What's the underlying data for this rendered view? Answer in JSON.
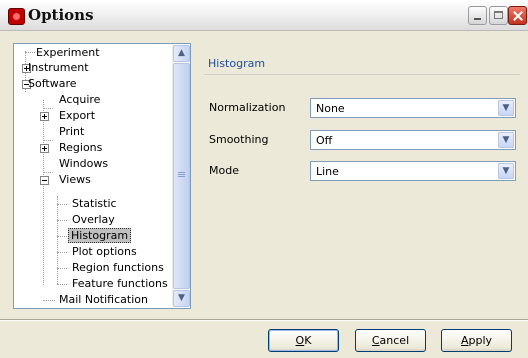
{
  "window": {
    "title": "Options"
  },
  "tree": {
    "items": [
      {
        "label": "Experiment"
      },
      {
        "label": "Instrument"
      },
      {
        "label": "Software"
      },
      {
        "label": "Acquire"
      },
      {
        "label": "Export"
      },
      {
        "label": "Print"
      },
      {
        "label": "Regions"
      },
      {
        "label": "Windows"
      },
      {
        "label": "Views"
      },
      {
        "label": "Statistic"
      },
      {
        "label": "Overlay"
      },
      {
        "label": "Histogram"
      },
      {
        "label": "Plot options"
      },
      {
        "label": "Region functions"
      },
      {
        "label": "Feature functions"
      },
      {
        "label": "Mail Notification"
      }
    ],
    "selected": "Histogram"
  },
  "panel": {
    "title": "Histogram",
    "fields": [
      {
        "label": "Normalization",
        "value": "None"
      },
      {
        "label": "Smoothing",
        "value": "Off"
      },
      {
        "label": "Mode",
        "value": "Line"
      }
    ]
  },
  "buttons": {
    "ok_accel": "O",
    "ok_rest": "K",
    "cancel_accel": "C",
    "cancel_rest": "ancel",
    "apply_accel": "A",
    "apply_rest": "pply"
  }
}
